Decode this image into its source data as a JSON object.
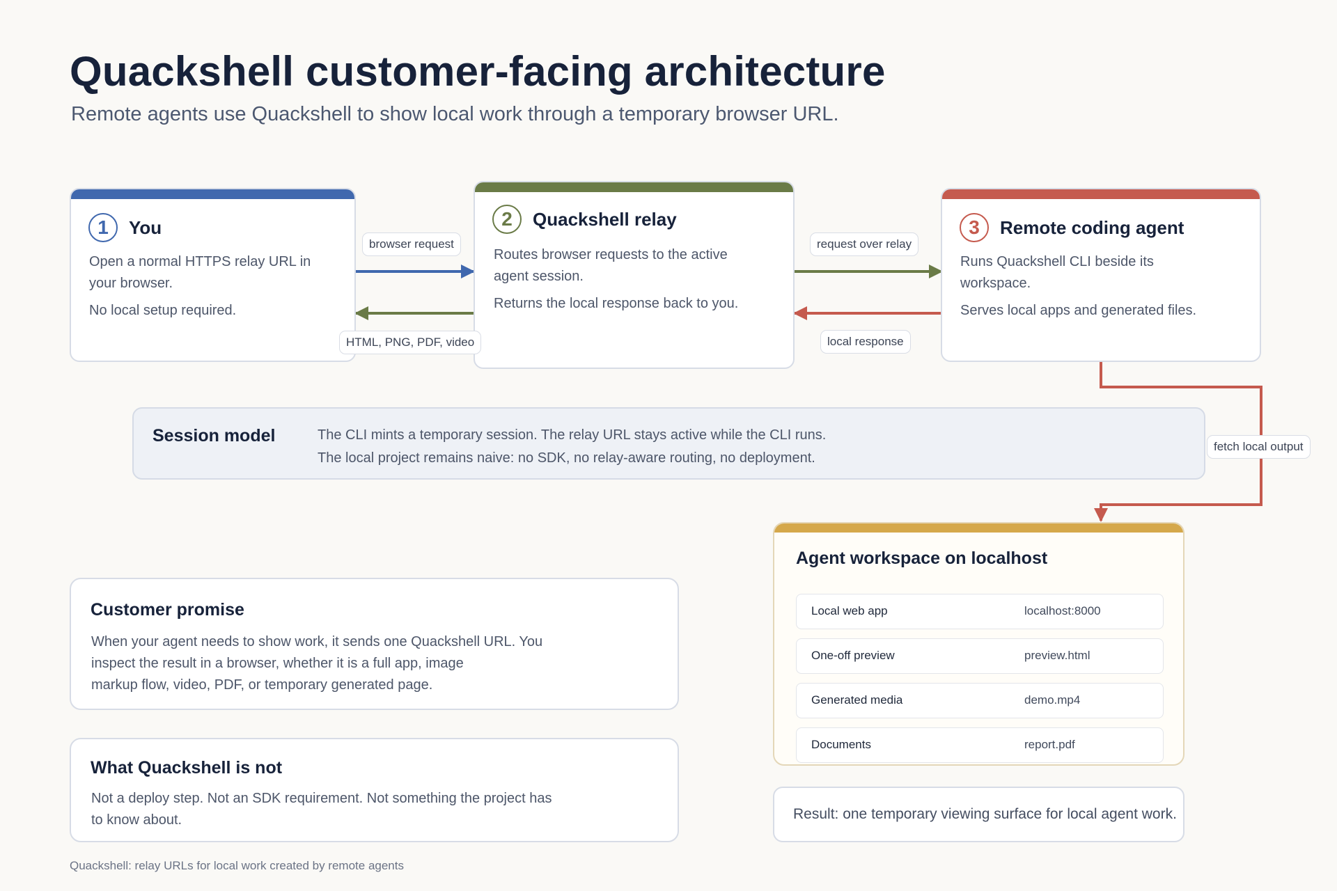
{
  "header": {
    "title": "Quackshell customer-facing architecture",
    "subtitle": "Remote agents use Quackshell to show local work through a temporary browser URL."
  },
  "colors": {
    "you": "#4068ae",
    "relay": "#6a7b47",
    "agent": "#c55a4e",
    "workspace": "#d5a84b"
  },
  "nodes": {
    "you": {
      "number": "1",
      "name": "You",
      "lines": [
        "Open a normal HTTPS relay URL in your browser.",
        "No local setup required."
      ]
    },
    "relay": {
      "number": "2",
      "name": "Quackshell relay",
      "lines": [
        "Routes browser requests to the active agent session.",
        "Returns the local response back to you."
      ]
    },
    "agent": {
      "number": "3",
      "name": "Remote coding agent",
      "lines": [
        "Runs Quackshell CLI beside its workspace.",
        "Serves local apps and generated files."
      ]
    }
  },
  "edges": {
    "browser_request": "browser request",
    "response_types": "HTML, PNG, PDF, video",
    "request_over_relay": "request over relay",
    "local_response": "local response",
    "fetch_local_output": "fetch local output"
  },
  "session_model": {
    "label": "Session model",
    "lines": [
      "The CLI mints a temporary session. The relay URL stays active while the CLI runs.",
      "The local project remains naive: no SDK, no relay-aware routing, no deployment."
    ]
  },
  "customer_promise": {
    "title": "Customer promise",
    "lines": [
      "When your agent needs to show work, it sends one Quackshell URL. You",
      "inspect the result in a browser, whether it is a full app, image",
      "markup flow, video, PDF, or temporary generated page."
    ]
  },
  "not": {
    "title": "What Quackshell is not",
    "lines": [
      "Not a deploy step. Not an SDK requirement. Not something the project has",
      "to know about."
    ]
  },
  "workspace": {
    "title": "Agent workspace on localhost",
    "rows": [
      {
        "label": "Local web app",
        "value": "localhost:8000"
      },
      {
        "label": "One-off preview",
        "value": "preview.html"
      },
      {
        "label": "Generated media",
        "value": "demo.mp4"
      },
      {
        "label": "Documents",
        "value": "report.pdf"
      }
    ]
  },
  "result": "Result: one temporary viewing surface for local agent work.",
  "footer": "Quackshell: relay URLs for local work created by remote agents"
}
